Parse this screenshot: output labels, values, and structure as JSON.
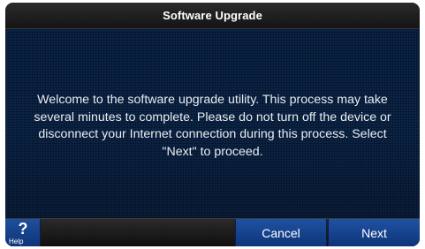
{
  "header": {
    "title": "Software Upgrade"
  },
  "main": {
    "message": "Welcome to the software upgrade utility. This process may take several minutes to complete. Please do not turn off the device or disconnect your Internet connection during this process. Select \"Next\" to proceed."
  },
  "footer": {
    "help_icon": "?",
    "help_label": "Help",
    "cancel_label": "Cancel",
    "next_label": "Next"
  },
  "colors": {
    "content_background": "#0b2244",
    "button_blue": "#1a4a99",
    "title_bar": "#1e1e1e"
  }
}
